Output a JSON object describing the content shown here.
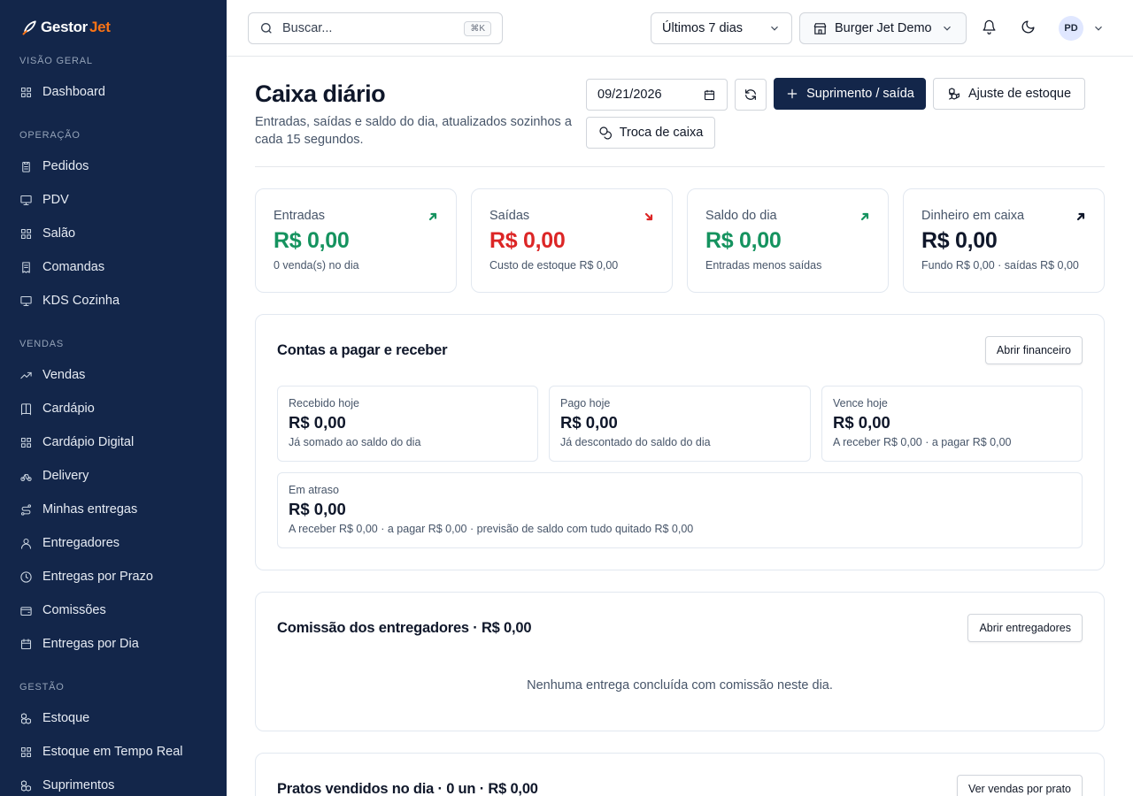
{
  "app": {
    "logo_text_a": "Gestor",
    "logo_text_b": "Jet"
  },
  "colors": {
    "sidebar_bg": "#13264a",
    "positive": "#15935f",
    "negative": "#dc2626",
    "accent_brand": "#f97316"
  },
  "sidebar": {
    "sections": [
      {
        "title": "VISÃO GERAL",
        "items": [
          {
            "label": "Dashboard",
            "icon": "grid-icon"
          }
        ]
      },
      {
        "title": "OPERAÇÃO",
        "items": [
          {
            "label": "Pedidos",
            "icon": "clipboard-icon"
          },
          {
            "label": "PDV",
            "icon": "monitor-icon"
          },
          {
            "label": "Salão",
            "icon": "grid-icon"
          },
          {
            "label": "Comandas",
            "icon": "receipt-icon"
          },
          {
            "label": "KDS Cozinha",
            "icon": "monitor-icon"
          }
        ]
      },
      {
        "title": "VENDAS",
        "items": [
          {
            "label": "Vendas",
            "icon": "trending-up-icon"
          },
          {
            "label": "Cardápio",
            "icon": "book-icon"
          },
          {
            "label": "Cardápio Digital",
            "icon": "grid-icon"
          },
          {
            "label": "Delivery",
            "icon": "bike-icon"
          },
          {
            "label": "Minhas entregas",
            "icon": "route-icon"
          },
          {
            "label": "Entregadores",
            "icon": "user-icon"
          },
          {
            "label": "Entregas por Prazo",
            "icon": "clock-icon"
          },
          {
            "label": "Comissões",
            "icon": "wallet-icon"
          },
          {
            "label": "Entregas por Dia",
            "icon": "calendar-icon"
          }
        ]
      },
      {
        "title": "GESTÃO",
        "items": [
          {
            "label": "Estoque",
            "icon": "boxes-icon"
          },
          {
            "label": "Estoque em Tempo Real",
            "icon": "grid-icon"
          },
          {
            "label": "Suprimentos",
            "icon": "boxes-icon"
          }
        ]
      }
    ]
  },
  "topbar": {
    "search_placeholder": "Buscar...",
    "search_shortcut": "⌘K",
    "period": "Últimos 7 dias",
    "store": "Burger Jet Demo",
    "avatar_initials": "PD"
  },
  "page": {
    "title": "Caixa diário",
    "subtitle": "Entradas, saídas e saldo do dia, atualizados sozinhos a cada 15 segundos.",
    "date_value": "09/21/2026",
    "buttons": {
      "supply": "Suprimento / saída",
      "stock_adjust": "Ajuste de estoque",
      "cash_change": "Troca de caixa"
    }
  },
  "kpis": [
    {
      "label": "Entradas",
      "value": "R$ 0,00",
      "note": "0 venda(s) no dia",
      "tone": "positive"
    },
    {
      "label": "Saídas",
      "value": "R$ 0,00",
      "note": "Custo de estoque R$ 0,00",
      "tone": "negative"
    },
    {
      "label": "Saldo do dia",
      "value": "R$ 0,00",
      "note": "Entradas menos saídas",
      "tone": "positive"
    },
    {
      "label": "Dinheiro em caixa",
      "value": "R$ 0,00",
      "note": "Fundo R$ 0,00 · saídas R$ 0,00",
      "tone": "neutral"
    }
  ],
  "accounts": {
    "title": "Contas a pagar e receber",
    "button": "Abrir financeiro",
    "received": {
      "label": "Recebido hoje",
      "value": "R$ 0,00",
      "note": "Já somado ao saldo do dia"
    },
    "paid": {
      "label": "Pago hoje",
      "value": "R$ 0,00",
      "note": "Já descontado do saldo do dia"
    },
    "due": {
      "label": "Vence hoje",
      "value": "R$ 0,00",
      "note": "A receber R$ 0,00 · a pagar R$ 0,00"
    },
    "overdue": {
      "label": "Em atraso",
      "value": "R$ 0,00",
      "note": "A receber R$ 0,00 · a pagar R$ 0,00 · previsão de saldo com tudo quitado R$ 0,00"
    }
  },
  "commission": {
    "title": "Comissão dos entregadores · R$ 0,00",
    "button": "Abrir entregadores",
    "empty": "Nenhuma entrega concluída com comissão neste dia."
  },
  "dishes": {
    "title": "Pratos vendidos no dia · 0 un · R$ 0,00",
    "button": "Ver vendas por prato"
  }
}
